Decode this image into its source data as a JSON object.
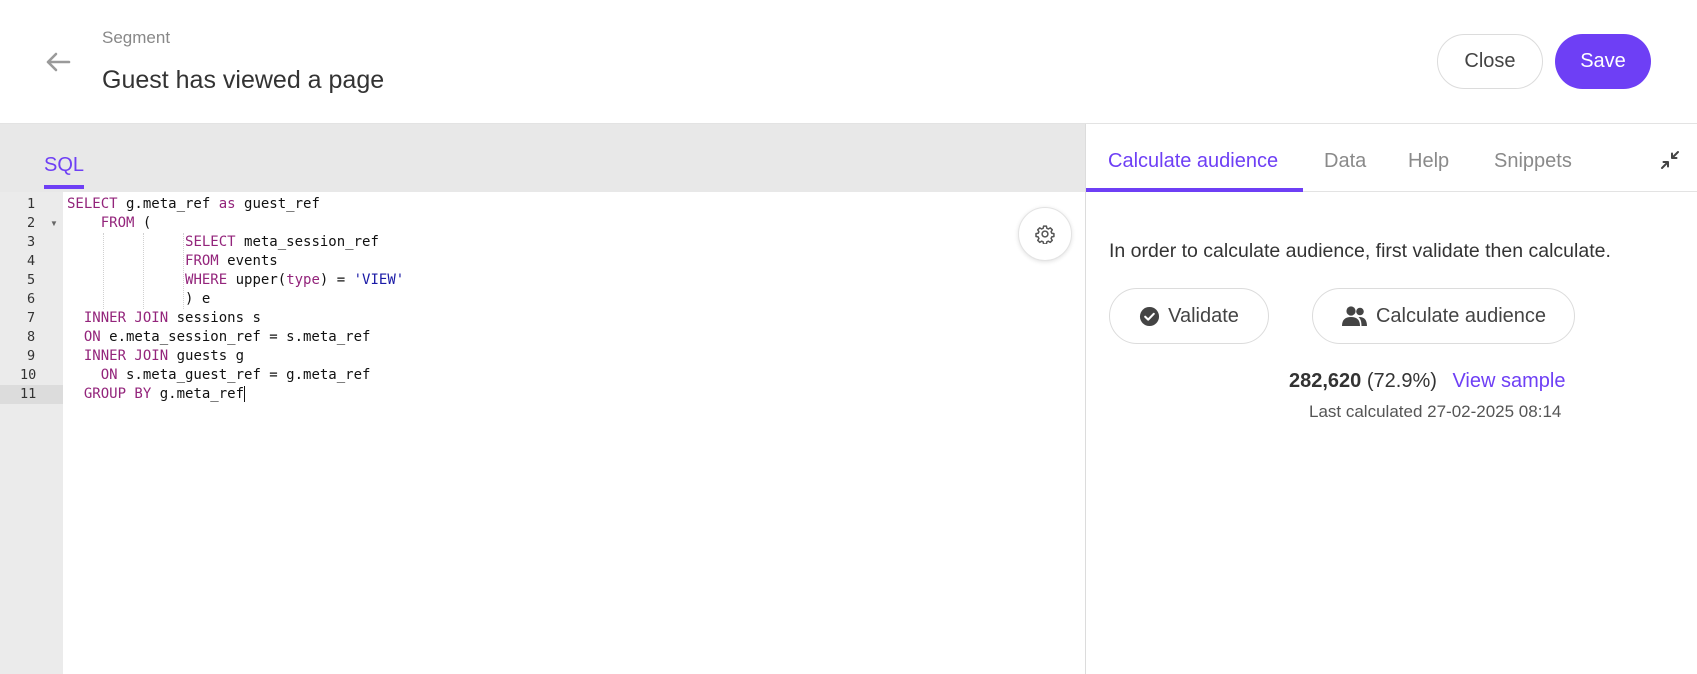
{
  "header": {
    "breadcrumb": "Segment",
    "title": "Guest has viewed a page",
    "close_label": "Close",
    "save_label": "Save"
  },
  "editor": {
    "tab_label": "SQL",
    "line_numbers": [
      "1",
      "2",
      "3",
      "4",
      "5",
      "6",
      "7",
      "8",
      "9",
      "10",
      "11"
    ],
    "lines": [
      [
        {
          "t": "SELECT",
          "c": "kw"
        },
        {
          "t": " g.meta_ref "
        },
        {
          "t": "as",
          "c": "kw"
        },
        {
          "t": " guest_ref"
        }
      ],
      [
        {
          "t": "    "
        },
        {
          "t": "FROM",
          "c": "kw"
        },
        {
          "t": " ("
        }
      ],
      [
        {
          "t": "              "
        },
        {
          "t": "SELECT",
          "c": "kw"
        },
        {
          "t": " meta_session_ref"
        }
      ],
      [
        {
          "t": "              "
        },
        {
          "t": "FROM",
          "c": "kw"
        },
        {
          "t": " events"
        }
      ],
      [
        {
          "t": "              "
        },
        {
          "t": "WHERE",
          "c": "kw"
        },
        {
          "t": " upper("
        },
        {
          "t": "type",
          "c": "kw"
        },
        {
          "t": ") = "
        },
        {
          "t": "'VIEW'",
          "c": "str"
        }
      ],
      [
        {
          "t": "              ) e"
        }
      ],
      [
        {
          "t": "  "
        },
        {
          "t": "INNER JOIN",
          "c": "kw"
        },
        {
          "t": " sessions s"
        }
      ],
      [
        {
          "t": "  "
        },
        {
          "t": "ON",
          "c": "kw"
        },
        {
          "t": " e.meta_session_ref = s.meta_ref"
        }
      ],
      [
        {
          "t": "  "
        },
        {
          "t": "INNER JOIN",
          "c": "kw"
        },
        {
          "t": " guests g"
        }
      ],
      [
        {
          "t": "    "
        },
        {
          "t": "ON",
          "c": "kw"
        },
        {
          "t": " s.meta_guest_ref = g.meta_ref"
        }
      ],
      [
        {
          "t": "  "
        },
        {
          "t": "GROUP BY",
          "c": "kw"
        },
        {
          "t": " g.meta_ref"
        }
      ]
    ]
  },
  "side_panel": {
    "tabs": [
      {
        "label": "Calculate audience"
      },
      {
        "label": "Data"
      },
      {
        "label": "Help"
      },
      {
        "label": "Snippets"
      }
    ],
    "info_text": "In order to calculate audience, first validate then calculate.",
    "validate_label": "Validate",
    "calculate_label": "Calculate audience",
    "result_count": "282,620",
    "result_pct": "(72.9%)",
    "view_sample_label": "View sample",
    "last_calculated": "Last calculated 27-02-2025 08:14"
  },
  "colors": {
    "accent": "#6e3ff5",
    "keyword": "#93247b",
    "string": "#1a1aa6"
  },
  "icons": {
    "back": "arrow-left-icon",
    "settings": "gear-icon",
    "collapse": "collapse-arrows-icon",
    "validate": "check-circle-icon",
    "calculate": "users-icon"
  }
}
